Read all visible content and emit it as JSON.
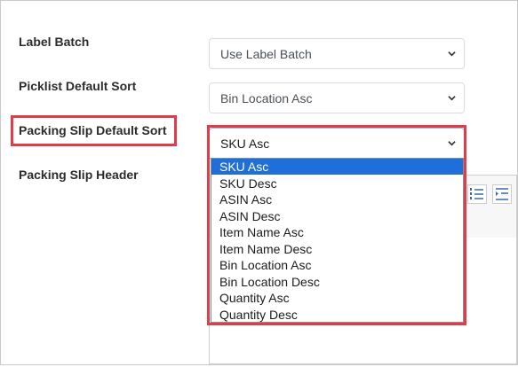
{
  "form": {
    "label_batch": {
      "label": "Label Batch",
      "value": "Use Label Batch"
    },
    "picklist_sort": {
      "label": "Picklist Default Sort",
      "value": "Bin Location Asc"
    },
    "packing_slip_sort": {
      "label": "Packing Slip Default Sort",
      "value": "SKU Asc"
    },
    "packing_slip_header": {
      "label": "Packing Slip Header"
    }
  },
  "dropdown": {
    "options": [
      "SKU Asc",
      "SKU Desc",
      "ASIN Asc",
      "ASIN Desc",
      "Item Name Asc",
      "Item Name Desc",
      "Bin Location Asc",
      "Bin Location Desc",
      "Quantity Asc",
      "Quantity Desc"
    ],
    "selected": "SKU Asc"
  },
  "colors": {
    "highlight": "#e03c4a",
    "selected_option": "#1e6fd9"
  },
  "icons": [
    "chevron-down-icon",
    "ordered-list-icon",
    "indent-icon"
  ]
}
